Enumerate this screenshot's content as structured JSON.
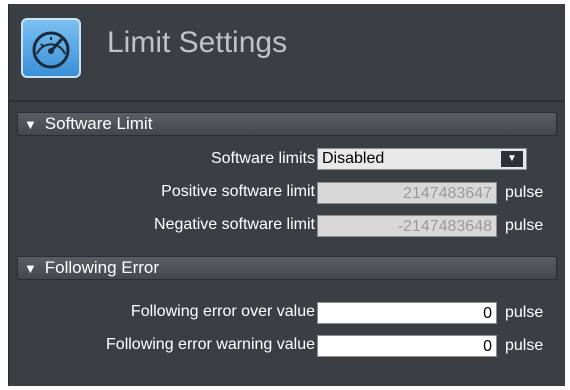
{
  "header": {
    "title": "Limit Settings",
    "icon": "speedometer-icon"
  },
  "sections": [
    {
      "label": "Software Limit",
      "rows": {
        "software_limits": {
          "label": "Software limits",
          "value": "Disabled"
        },
        "positive": {
          "label": "Positive software limit",
          "value": "2147483647",
          "unit": "pulse"
        },
        "negative": {
          "label": "Negative software limit",
          "value": "-2147483648",
          "unit": "pulse"
        }
      }
    },
    {
      "label": "Following Error",
      "rows": {
        "over": {
          "label": "Following error over value",
          "value": "0",
          "unit": "pulse"
        },
        "warning": {
          "label": "Following error warning value",
          "value": "0",
          "unit": "pulse"
        }
      }
    }
  ],
  "colors": {
    "panel_bg": "#3b3f44",
    "icon_blue": "#5aa8e6",
    "disabled_field": "#d8d8d8"
  }
}
